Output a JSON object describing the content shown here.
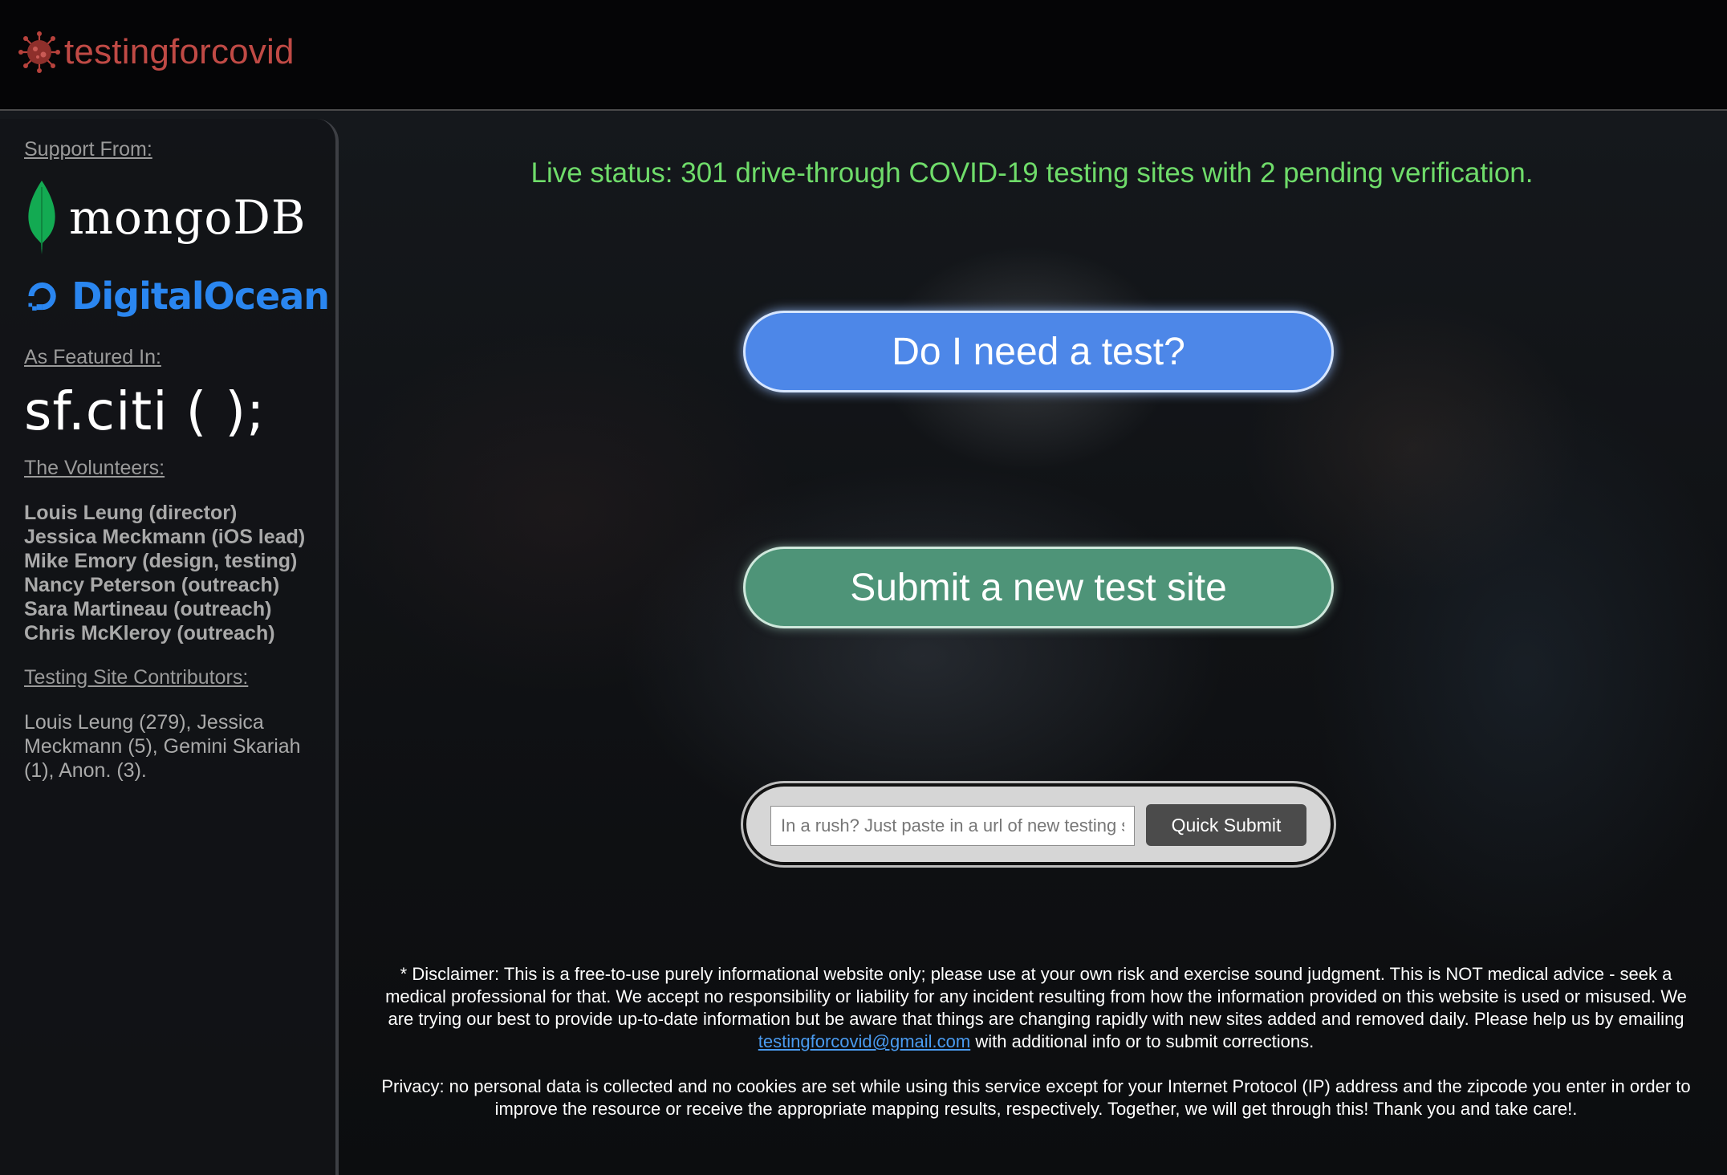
{
  "header": {
    "logo_text": "testingforcovid",
    "logo_icon": "virus-icon",
    "brand_color": "#c04a45"
  },
  "sidebar": {
    "support_title": "Support From:",
    "sponsors": [
      {
        "name": "mongoDB",
        "icon": "leaf-icon",
        "color": "#13aa52"
      },
      {
        "name": "DigitalOcean",
        "icon": "digitalocean-icon",
        "color": "#2a86f0"
      }
    ],
    "featured_title": "As Featured In:",
    "featured": "sf.citi ( );",
    "volunteers_title": "The Volunteers:",
    "volunteers": [
      "Louis Leung (director)",
      "Jessica Meckmann (iOS lead)",
      "Mike Emory (design, testing)",
      "Nancy Peterson (outreach)",
      "Sara Martineau (outreach)",
      "Chris McKleroy (outreach)"
    ],
    "contributors_title": "Testing Site Contributors:",
    "contributors": "Louis Leung (279), Jessica Meckmann (5), Gemini Skariah (1), Anon. (3)."
  },
  "main": {
    "status": "Live status: 301 drive-through COVID-19 testing sites with 2 pending verification.",
    "status_color": "#6fdc6a",
    "need_test_label": "Do I need a test?",
    "submit_site_label": "Submit a new test site",
    "quick_submit": {
      "placeholder": "In a rush? Just paste in a url of new testing site",
      "button_label": "Quick Submit"
    }
  },
  "footer": {
    "disclaimer_pre": "* Disclaimer: This is a free-to-use purely informational website only; please use at your own risk and exercise sound judgment. This is NOT medical advice - seek a medical professional for that. We accept no responsibility or liability for any incident resulting from how the information provided on this website is used or misused. We are trying our best to provide up-to-date information but be aware that things are changing rapidly with new sites added and removed daily. Please help us by emailing",
    "email": "testingforcovid@gmail.com",
    "disclaimer_post": "with additional info or to submit corrections.",
    "privacy": "Privacy: no personal data is collected and no cookies are set while using this service except for your Internet Protocol (IP) address and the zipcode you enter in order to improve the resource or receive the appropriate mapping results, respectively. Together, we will get through this! Thank you and take care!."
  }
}
